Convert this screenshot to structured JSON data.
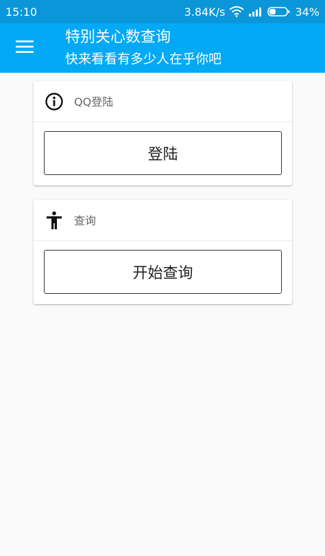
{
  "status_bar": {
    "time": "15:10",
    "net_speed": "3.84K/s",
    "battery_percent": "34%",
    "wifi_icon": "wifi-icon",
    "signal_icon": "signal-icon",
    "battery_icon": "battery-icon",
    "battery_level": 0.34,
    "background": "#0a96d8"
  },
  "app_bar": {
    "title": "特别关心数查询",
    "subtitle": "快来看看有多少人在乎你吧",
    "menu_icon": "menu-icon",
    "background": "#03a9f4"
  },
  "cards": {
    "login": {
      "header_label": "QQ登陆",
      "header_icon": "info-icon",
      "button_label": "登陆"
    },
    "query": {
      "header_label": "查询",
      "header_icon": "accessibility-icon",
      "button_label": "开始查询"
    }
  }
}
